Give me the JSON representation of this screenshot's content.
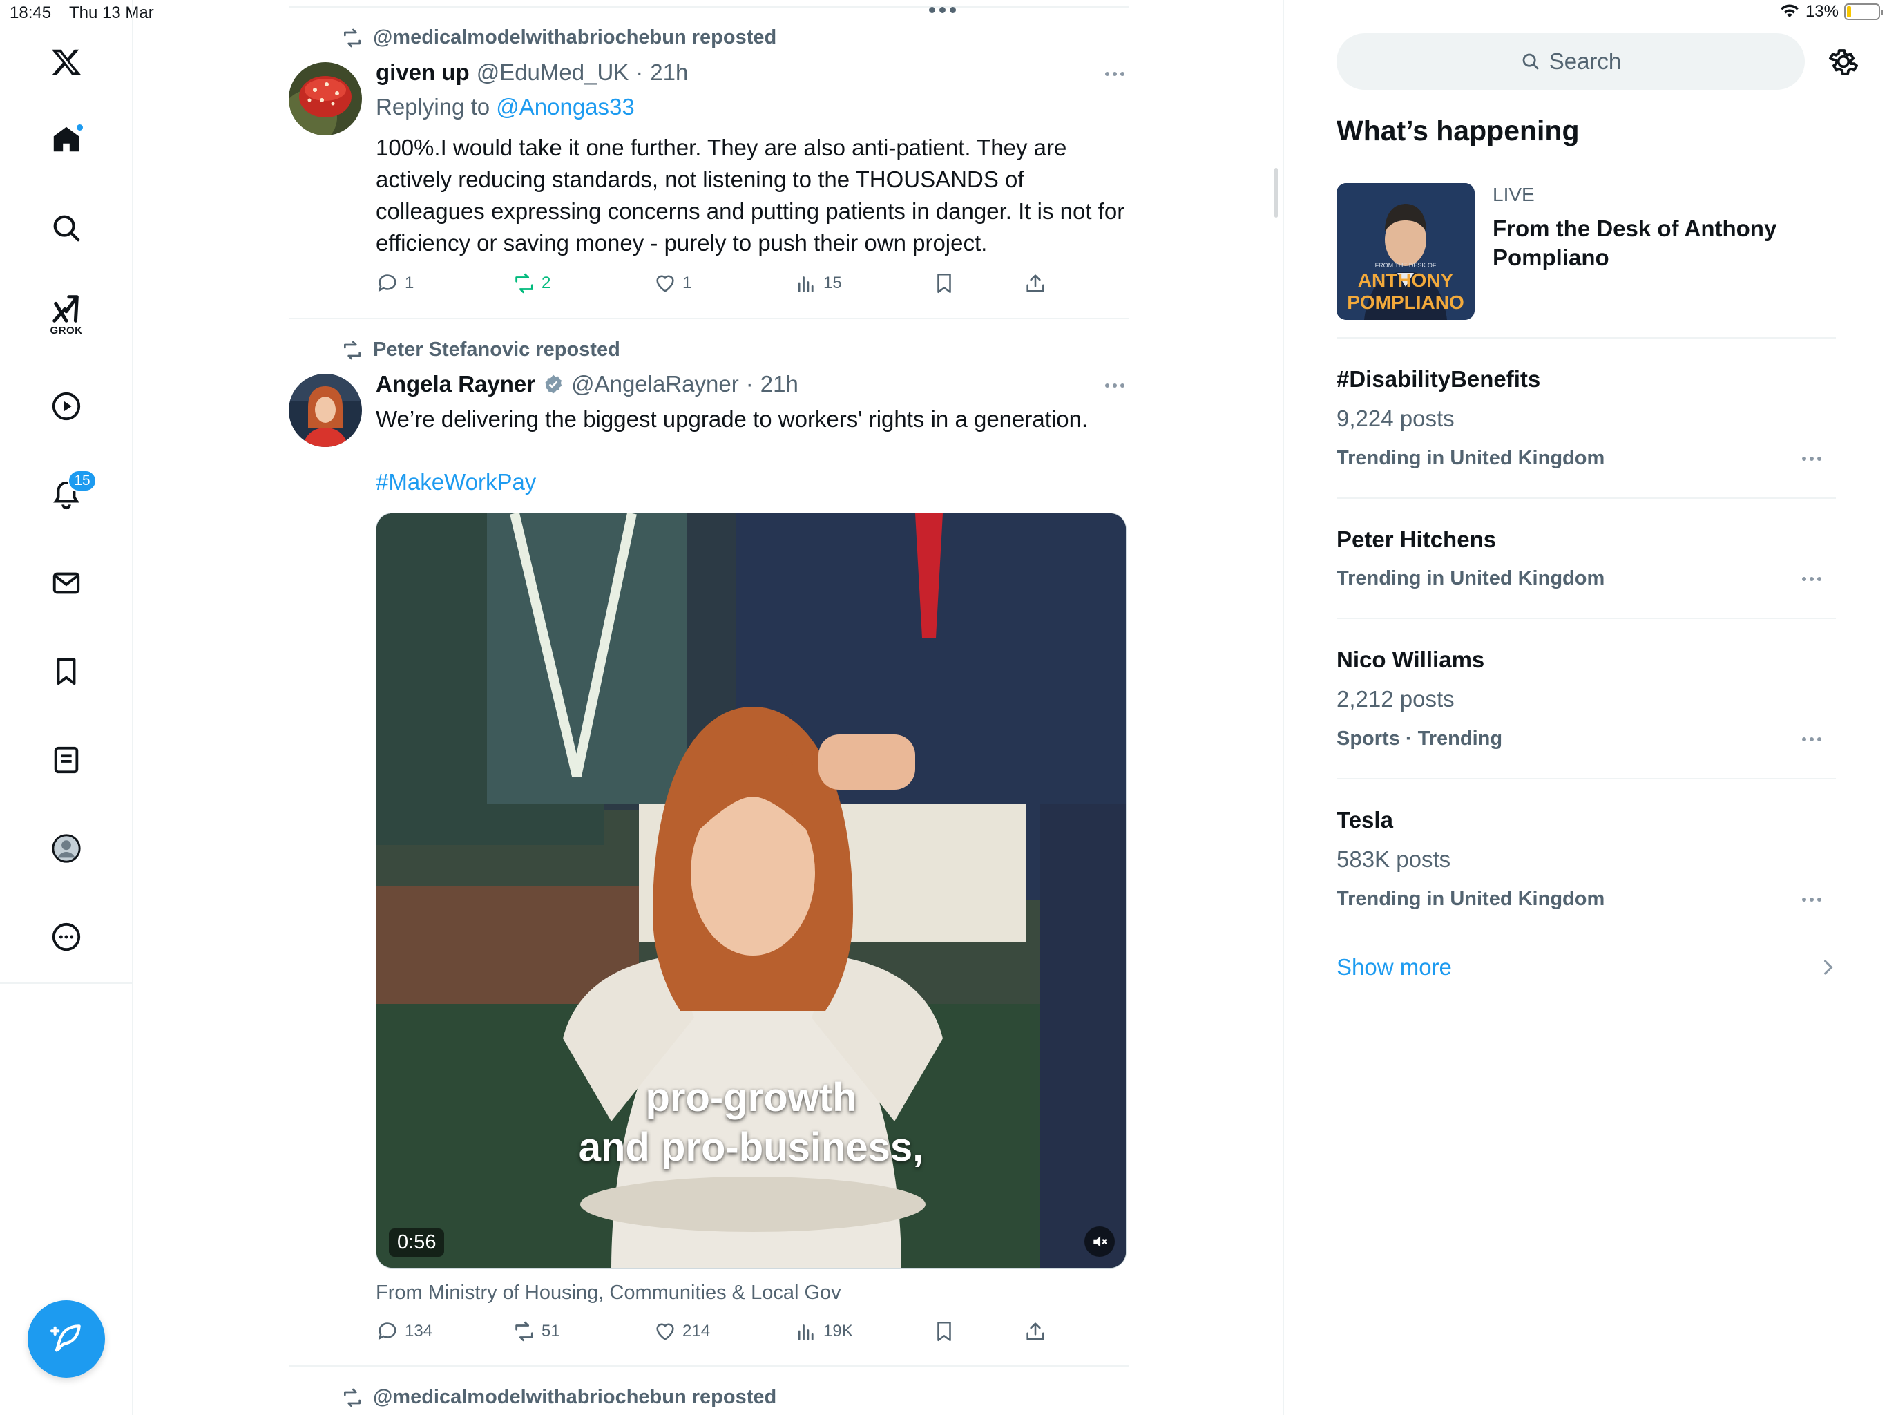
{
  "status_bar": {
    "time": "18:45",
    "date": "Thu 13 Mar",
    "battery": "13%",
    "battery_level": 0.13
  },
  "nav": {
    "notifications_badge": "15",
    "grok_label": "GROK",
    "items": [
      "x-logo-icon",
      "home-icon",
      "search-icon",
      "grok-icon",
      "video-icon",
      "notifications-icon",
      "messages-icon",
      "bookmarks-icon",
      "lists-icon",
      "profile-icon",
      "more-icon"
    ]
  },
  "feed": {
    "tweet1": {
      "repost_by": "@medicalmodelwithabriochebun reposted",
      "name": "given up",
      "handle": "@EduMed_UK",
      "time": "21h",
      "replying_prefix": "Replying to ",
      "replying_handle": "@Anongas33",
      "text": "100%.I would take it one further. They are also anti-patient. They are actively reducing standards, not listening to the THOUSANDS of colleagues expressing concerns and putting patients in danger. It is not for efficiency or saving money - purely to push their own project.",
      "replies": "1",
      "reposts": "2",
      "likes": "1",
      "views": "15"
    },
    "tweet2": {
      "repost_by": "Peter Stefanovic reposted",
      "name": "Angela Rayner",
      "handle": "@AngelaRayner",
      "time": "21h",
      "text": "We’re delivering the biggest upgrade to workers' rights in a generation.",
      "hashtag": "#MakeWorkPay",
      "caption_line1": "pro-growth",
      "caption_line2": "and pro-business,",
      "duration": "0:56",
      "from": "From Ministry of Housing, Communities & Local Gov",
      "replies": "134",
      "reposts": "51",
      "likes": "214",
      "views": "19K"
    },
    "tweet3": {
      "repost_by": "@medicalmodelwithabriochebun reposted"
    }
  },
  "sidebar": {
    "search_placeholder": "Search",
    "section_title": "What’s happening",
    "live": {
      "label": "LIVE",
      "title": "From the Desk of Anthony Pompliano",
      "thumb_small": "FROM THE DESK OF",
      "thumb_line1": "ANTHONY",
      "thumb_line2": "POMPLIANO"
    },
    "trends": [
      {
        "name": "#DisabilityBenefits",
        "posts": "9,224 posts",
        "context": "Trending in United Kingdom"
      },
      {
        "name": "Peter Hitchens",
        "posts": "",
        "context": "Trending in United Kingdom"
      },
      {
        "name": "Nico Williams",
        "posts": "2,212 posts",
        "context": "Sports · Trending"
      },
      {
        "name": "Tesla",
        "posts": "583K posts",
        "context": "Trending in United Kingdom"
      }
    ],
    "show_more": "Show more"
  },
  "colors": {
    "accent": "#1d9bf0",
    "repost_green": "#00ba7c",
    "muted": "#536471",
    "text": "#0f1419"
  }
}
